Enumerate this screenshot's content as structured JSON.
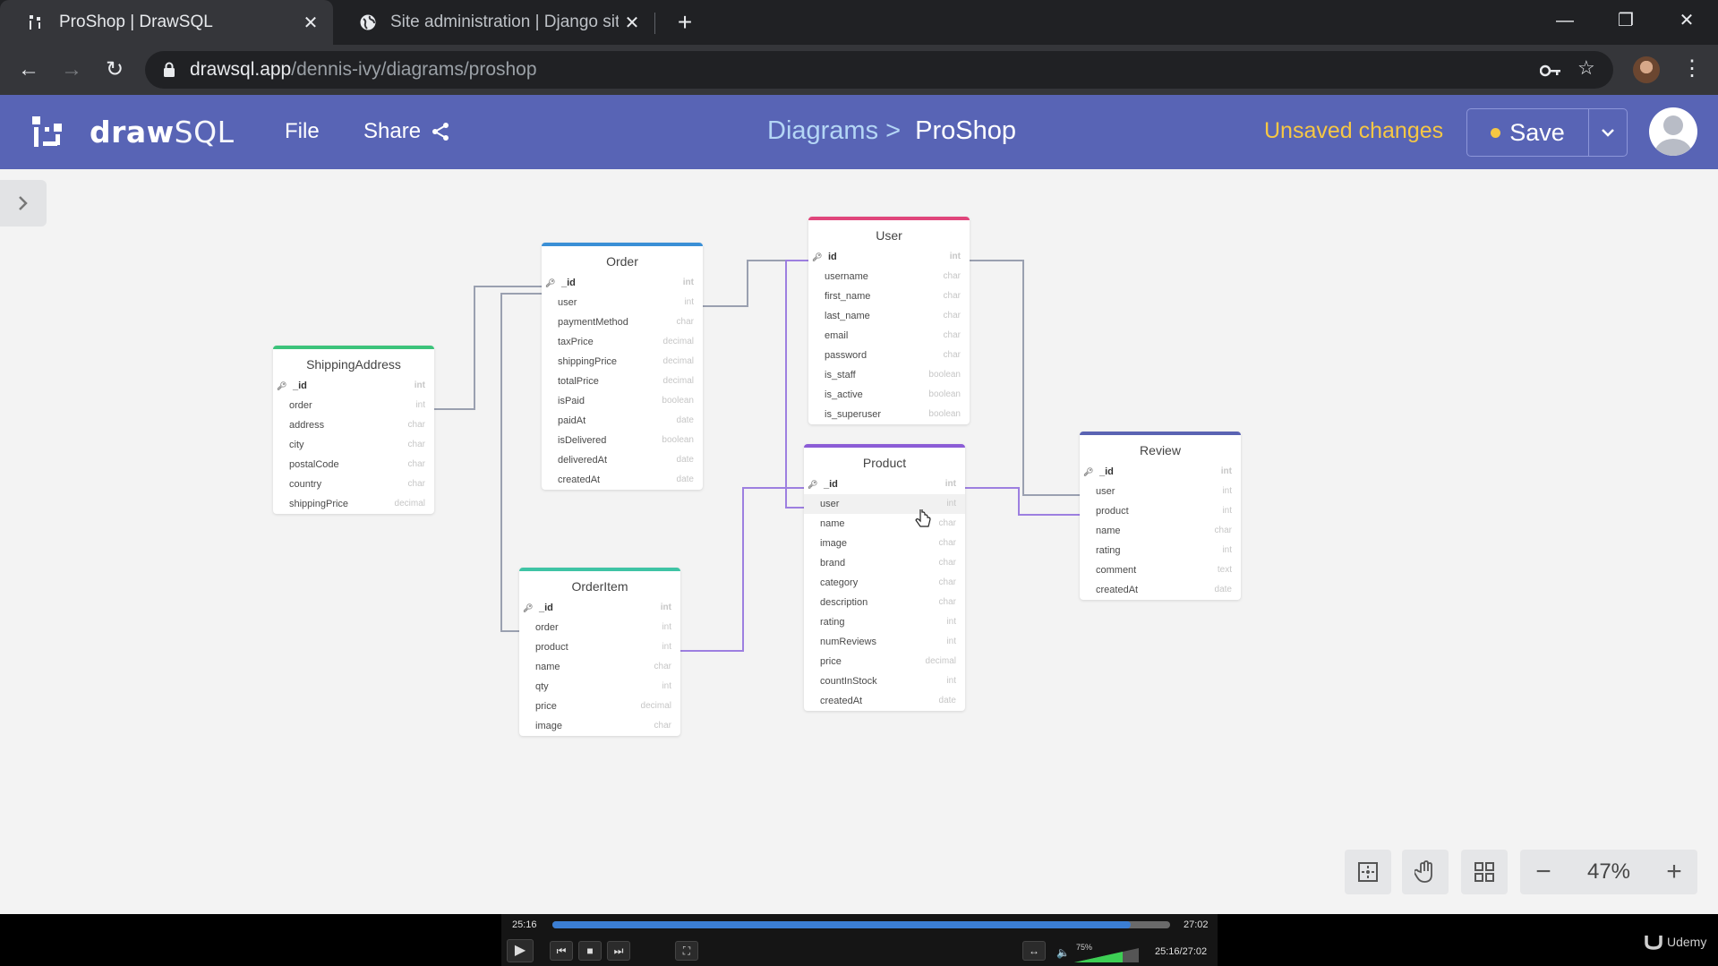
{
  "browser": {
    "tabs": [
      {
        "title": "ProShop | DrawSQL",
        "close": "✕"
      },
      {
        "title": "Site administration | Django site admin",
        "close": "✕"
      }
    ],
    "new_tab": "+",
    "window_controls": {
      "minimize": "—",
      "restore": "❐",
      "close": "✕"
    },
    "url_host": "drawsql.app",
    "url_path": "/dennis-ivy/diagrams/proshop"
  },
  "app": {
    "brand_bold": "draw",
    "brand_light": "SQL",
    "menu": {
      "file": "File",
      "share": "Share"
    },
    "breadcrumb": {
      "parent": "Diagrams",
      "separator": ">",
      "current": "ProShop"
    },
    "unsaved": "Unsaved changes",
    "save_label": "Save"
  },
  "colors": {
    "header": "#5864b5",
    "order": "#3a8fd6",
    "user": "#e0457b",
    "shipping": "#3cc37b",
    "product": "#8b5cd6",
    "review": "#5a63b3",
    "orderitem": "#3fc4a5",
    "wire": "#9aa0b0",
    "wire_active": "#9d7fe0"
  },
  "tables": [
    {
      "id": "order",
      "name": "Order",
      "color": "order",
      "fields": [
        {
          "name": "_id",
          "type": "int",
          "pk": true
        },
        {
          "name": "user",
          "type": "int"
        },
        {
          "name": "paymentMethod",
          "type": "char"
        },
        {
          "name": "taxPrice",
          "type": "decimal"
        },
        {
          "name": "shippingPrice",
          "type": "decimal"
        },
        {
          "name": "totalPrice",
          "type": "decimal"
        },
        {
          "name": "isPaid",
          "type": "boolean"
        },
        {
          "name": "paidAt",
          "type": "date"
        },
        {
          "name": "isDelivered",
          "type": "boolean"
        },
        {
          "name": "deliveredAt",
          "type": "date"
        },
        {
          "name": "createdAt",
          "type": "date"
        }
      ]
    },
    {
      "id": "user",
      "name": "User",
      "color": "user",
      "fields": [
        {
          "name": "id",
          "type": "int",
          "pk": true
        },
        {
          "name": "username",
          "type": "char"
        },
        {
          "name": "first_name",
          "type": "char"
        },
        {
          "name": "last_name",
          "type": "char"
        },
        {
          "name": "email",
          "type": "char"
        },
        {
          "name": "password",
          "type": "char"
        },
        {
          "name": "is_staff",
          "type": "boolean"
        },
        {
          "name": "is_active",
          "type": "boolean"
        },
        {
          "name": "is_superuser",
          "type": "boolean"
        }
      ]
    },
    {
      "id": "shipping",
      "name": "ShippingAddress",
      "color": "shipping",
      "fields": [
        {
          "name": "_id",
          "type": "int",
          "pk": true
        },
        {
          "name": "order",
          "type": "int"
        },
        {
          "name": "address",
          "type": "char"
        },
        {
          "name": "city",
          "type": "char"
        },
        {
          "name": "postalCode",
          "type": "char"
        },
        {
          "name": "country",
          "type": "char"
        },
        {
          "name": "shippingPrice",
          "type": "decimal"
        }
      ]
    },
    {
      "id": "product",
      "name": "Product",
      "color": "product",
      "fields": [
        {
          "name": "_id",
          "type": "int",
          "pk": true
        },
        {
          "name": "user",
          "type": "int",
          "highlight": true
        },
        {
          "name": "name",
          "type": "char"
        },
        {
          "name": "image",
          "type": "char"
        },
        {
          "name": "brand",
          "type": "char"
        },
        {
          "name": "category",
          "type": "char"
        },
        {
          "name": "description",
          "type": "char"
        },
        {
          "name": "rating",
          "type": "int"
        },
        {
          "name": "numReviews",
          "type": "int"
        },
        {
          "name": "price",
          "type": "decimal"
        },
        {
          "name": "countInStock",
          "type": "int"
        },
        {
          "name": "createdAt",
          "type": "date"
        }
      ]
    },
    {
      "id": "review",
      "name": "Review",
      "color": "review",
      "fields": [
        {
          "name": "_id",
          "type": "int",
          "pk": true
        },
        {
          "name": "user",
          "type": "int"
        },
        {
          "name": "product",
          "type": "int"
        },
        {
          "name": "name",
          "type": "char"
        },
        {
          "name": "rating",
          "type": "int"
        },
        {
          "name": "comment",
          "type": "text"
        },
        {
          "name": "createdAt",
          "type": "date"
        }
      ]
    },
    {
      "id": "orderitem",
      "name": "OrderItem",
      "color": "orderitem",
      "fields": [
        {
          "name": "_id",
          "type": "int",
          "pk": true
        },
        {
          "name": "order",
          "type": "int"
        },
        {
          "name": "product",
          "type": "int"
        },
        {
          "name": "name",
          "type": "char"
        },
        {
          "name": "qty",
          "type": "int"
        },
        {
          "name": "price",
          "type": "decimal"
        },
        {
          "name": "image",
          "type": "char"
        }
      ]
    }
  ],
  "zoom": {
    "level": "47%",
    "minus": "−",
    "plus": "+"
  },
  "player": {
    "current": "25:16",
    "total": "27:02",
    "combined": "25:16/27:02",
    "progress": 0.936,
    "volume": "75%",
    "volume_level": 0.75,
    "watermark": "Udemy"
  }
}
